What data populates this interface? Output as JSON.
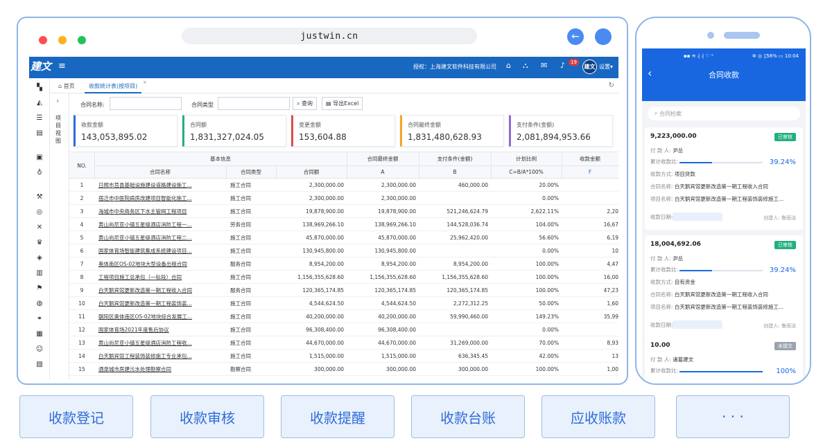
{
  "browser": {
    "url": "justwin.cn",
    "dot_colors": [
      "#ff4d4f",
      "#ffb020",
      "#23c25a"
    ],
    "accent": "#4a8bf0"
  },
  "app": {
    "logo": "建文",
    "menu_icon": "≡",
    "org": "授权：上海建文软件科技有限公司",
    "notification_count": "19",
    "brand_short": "建文",
    "settings_label": "设置▾",
    "topbar_color": "#1867c0",
    "tabs": [
      {
        "label": "首页"
      },
      {
        "label": "收款统计表(按项目)"
      }
    ],
    "tree_label": "项目视图",
    "filters": {
      "name_label": "合同名称:",
      "type_label": "合同类型",
      "query_button": "查询",
      "export_button": "导出Excel"
    },
    "cards": [
      {
        "label": "收款金额",
        "value": "143,053,895.02",
        "color": "#2f6bd8"
      },
      {
        "label": "合同额",
        "value": "1,831,327,024.05",
        "color": "#22b07d"
      },
      {
        "label": "变更金额",
        "value": "153,604.88",
        "color": "#e24a4a"
      },
      {
        "label": "合同最终金额",
        "value": "1,831,480,628.93",
        "color": "#f5a623"
      },
      {
        "label": "支付条件(金额)",
        "value": "2,081,894,953.66",
        "color": "#8e6bd8"
      }
    ],
    "table": {
      "header_no": "NO.",
      "header_basic": "基本信息",
      "header_name": "合同名称",
      "header_type": "合同类型",
      "header_amount": "合同额",
      "header_final": "合同最终金额",
      "header_final_sub": "A",
      "header_pay": "支付条件(金额)",
      "header_pay_sub": "B",
      "header_ratio": "计划比例",
      "header_ratio_sub": "C=B/A*100%",
      "header_recv": "收款金额",
      "header_recv_sub": "F",
      "rows": [
        {
          "no": "1",
          "name": "日照市莒县基础设施建设道路建设施工...",
          "type": "施工合同",
          "amount": "2,300,000.00",
          "final": "2,300,000.00",
          "pay": "460,000.00",
          "ratio": "20.00%",
          "recv": ""
        },
        {
          "no": "2",
          "name": "宿迁市中医院病房改建项目智能化施工...",
          "type": "施工合同",
          "amount": "2,300,000.00",
          "final": "2,300,000.00",
          "pay": "",
          "ratio": "0.00%",
          "recv": ""
        },
        {
          "no": "3",
          "name": "海城市中央商务区下水主管网工程项目",
          "type": "施工合同",
          "amount": "19,878,900.00",
          "final": "19,878,900.00",
          "pay": "521,246,624.79",
          "ratio": "2,622.11%",
          "recv": "2,208,5"
        },
        {
          "no": "4",
          "name": "黄山尚尼亚小镇五星级酒店消防工程一...",
          "type": "劳务合同",
          "amount": "138,969,266.10",
          "final": "138,969,266.10",
          "pay": "144,528,036.74",
          "ratio": "104.00%",
          "recv": "16,676,3"
        },
        {
          "no": "5",
          "name": "黄山尚尼亚小镇五星级酒店消防工程二...",
          "type": "施工合同",
          "amount": "45,870,000.00",
          "final": "45,870,000.00",
          "pay": "25,962,420.00",
          "ratio": "56.60%",
          "recv": "6,199,8"
        },
        {
          "no": "6",
          "name": "国家体育场智能建筑集成系统建设项目...",
          "type": "施工合同",
          "amount": "130,945,800.00",
          "final": "130,945,800.00",
          "pay": "",
          "ratio": "0.00%",
          "recv": "100,0"
        },
        {
          "no": "7",
          "name": "奥体南区OS-02地块大型设备出租合同",
          "type": "服务合同",
          "amount": "8,954,200.00",
          "final": "8,954,200.00",
          "pay": "8,954,200.00",
          "ratio": "100.00%",
          "recv": "4,477,1"
        },
        {
          "no": "8",
          "name": "工程项目施工总承包（一标段）合同",
          "type": "施工合同",
          "amount": "1,156,355,628.60",
          "final": "1,156,355,628.60",
          "pay": "1,156,355,628.60",
          "ratio": "100.00%",
          "recv": "16,006,5"
        },
        {
          "no": "9",
          "name": "白天鹅宾馆更新改造第一期工程收入合同",
          "type": "服务合同",
          "amount": "120,365,174.85",
          "final": "120,365,174.85",
          "pay": "120,365,174.85",
          "ratio": "100.00%",
          "recv": "47,232,3"
        },
        {
          "no": "10",
          "name": "白天鹅宾馆更新改造第一期工程装饰装...",
          "type": "施工合同",
          "amount": "4,544,624.50",
          "final": "4,544,624.50",
          "pay": "2,272,312.25",
          "ratio": "50.00%",
          "recv": "1,600,1"
        },
        {
          "no": "11",
          "name": "朝阳区奥体南区OS-02地块综合发展工...",
          "type": "施工合同",
          "amount": "40,200,000.00",
          "final": "40,200,000.00",
          "pay": "59,990,460.00",
          "ratio": "149.23%",
          "recv": "35,999,1"
        },
        {
          "no": "12",
          "name": "国家体育场2021年度售后协议",
          "type": "施工合同",
          "amount": "96,308,400.00",
          "final": "96,308,400.00",
          "pay": "",
          "ratio": "0.00%",
          "recv": ""
        },
        {
          "no": "13",
          "name": "黄山尚尼亚小镇五星级酒店消防工程收...",
          "type": "施工合同",
          "amount": "44,670,000.00",
          "final": "44,670,000.00",
          "pay": "31,269,000.00",
          "ratio": "70.00%",
          "recv": "8,934,0"
        },
        {
          "no": "14",
          "name": "白天鹅宾馆工程装饰装修施工专业承包...",
          "type": "施工合同",
          "amount": "1,515,000.00",
          "final": "1,515,000.00",
          "pay": "636,345.45",
          "ratio": "42.00%",
          "recv": "136,3"
        },
        {
          "no": "15",
          "name": "酒泉城市房建污水处理勘察合同",
          "type": "勘察合同",
          "amount": "300,000.00",
          "final": "300,000.00",
          "pay": "300,000.00",
          "ratio": "100.00%",
          "recv": "1,000,0"
        }
      ]
    }
  },
  "phone": {
    "status_left": "▪▪ ≋ ᵢ| ᵢ| ♡ ᵃ",
    "status_right": "✲ ◎ ▯58% ▭ 10:04",
    "title": "合同收款",
    "search_placeholder": "合同检索",
    "cards": [
      {
        "amount": "9,223,000.00",
        "status": "已审核",
        "status_color": "#22b07d",
        "payer_label": "付 款 人:",
        "payer": "尹总",
        "ratio_label": "累计收款比:",
        "ratio": "39.24%",
        "ratio_fraction": 0.3924,
        "method_label": "收款方式:",
        "method": "项目贷款",
        "contract_label": "合同名称:",
        "contract": "白天鹅宾馆更新改造第一期工程收入合同",
        "project_label": "项目名称:",
        "project": "白天鹅宾馆更新改造第一期工程装饰装修施工...",
        "date_label": "收款日期:",
        "creator": "创建人: 鲁雨洁"
      },
      {
        "amount": "18,004,692.06",
        "status": "已审核",
        "status_color": "#22b07d",
        "payer_label": "付 款 人:",
        "payer": "尹总",
        "ratio_label": "累计收款比:",
        "ratio": "39.24%",
        "ratio_fraction": 0.3924,
        "method_label": "收款方式:",
        "method": "自有资金",
        "contract_label": "合同名称:",
        "contract": "白天鹅宾馆更新改造第一期工程收入合同",
        "project_label": "项目名称:",
        "project": "白天鹅宾馆更新改造第一期工程装饰装修施工...",
        "date_label": "收款日期:",
        "creator": "创建人: 鲁雨洁"
      },
      {
        "amount": "10.00",
        "status": "未提交",
        "status_color": "#9aa3ad",
        "payer_label": "付 款 人:",
        "payer": "诸葛建文",
        "ratio_label": "累计收款比:",
        "ratio": "100%",
        "ratio_fraction": 1.0
      }
    ]
  },
  "features": [
    {
      "label": "收款登记"
    },
    {
      "label": "收款审核"
    },
    {
      "label": "收款提醒"
    },
    {
      "label": "收款台账"
    },
    {
      "label": "应收账款"
    },
    {
      "label": "· · ·"
    }
  ]
}
